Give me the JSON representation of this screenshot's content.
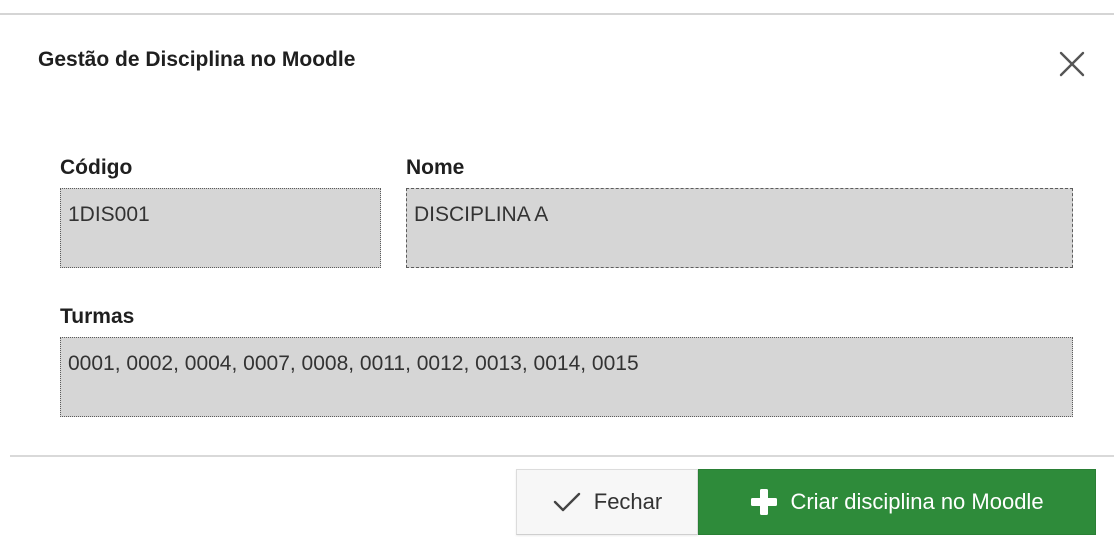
{
  "dialog": {
    "title": "Gestão de Disciplina no Moodle",
    "close_icon": "close-icon"
  },
  "form": {
    "codigo": {
      "label": "Código",
      "value": "1DIS001"
    },
    "nome": {
      "label": "Nome",
      "value": "DISCIPLINA A"
    },
    "turmas": {
      "label": "Turmas",
      "value": "0001, 0002, 0004, 0007, 0008, 0011, 0012, 0013, 0014, 0015"
    }
  },
  "footer": {
    "close_button": {
      "label": "Fechar",
      "icon": "checkmark-icon"
    },
    "create_button": {
      "label": "Criar disciplina no Moodle",
      "icon": "plus-icon",
      "color": "#2e8b3a"
    }
  }
}
